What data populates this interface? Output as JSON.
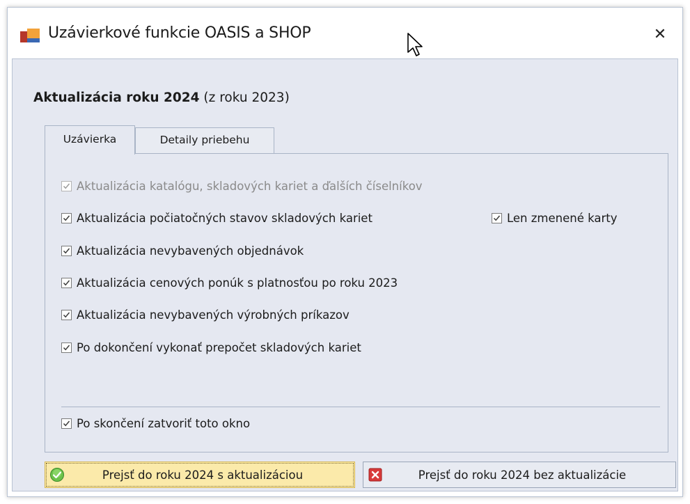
{
  "window": {
    "title": "Uzávierkové funkcie OASIS a SHOP",
    "close_glyph": "✕",
    "logo_icon": "oasis-logo-icon"
  },
  "heading": {
    "bold": "Aktualizácia roku 2024",
    "rest": " (z roku 2023)"
  },
  "tabs": [
    {
      "label": "Uzávierka",
      "active": true
    },
    {
      "label": "Detaily priebehu",
      "active": false
    }
  ],
  "options": [
    {
      "label": "Aktualizácia katalógu, skladových kariet a ďalších číselníkov",
      "checked": true,
      "disabled": true
    },
    {
      "label": "Aktualizácia počiatočných stavov skladových kariet",
      "checked": true,
      "disabled": false
    },
    {
      "label": "Aktualizácia nevybavených objednávok",
      "checked": true,
      "disabled": false
    },
    {
      "label": "Aktualizácia cenových ponúk s platnosťou po roku 2023",
      "checked": true,
      "disabled": false
    },
    {
      "label": "Aktualizácia nevybavených výrobných príkazov",
      "checked": true,
      "disabled": false
    },
    {
      "label": "Po dokončení vykonať prepočet skladových kariet",
      "checked": true,
      "disabled": false
    }
  ],
  "side_option": {
    "label": "Len zmenené karty",
    "checked": true
  },
  "close_option": {
    "label": "Po skončení zatvoriť toto okno",
    "checked": true
  },
  "buttons": {
    "primary": {
      "label": "Prejsť do roku 2024 s aktualizáciou",
      "icon": "green-check-circle-icon"
    },
    "secondary": {
      "label": "Prejsť do roku 2024 bez aktualizácie",
      "icon": "red-x-icon"
    }
  },
  "colors": {
    "panel_bg": "#e5e8f1",
    "primary_button_bg": "#fbeaaa",
    "check_green": "#3aa33a",
    "x_red": "#d83a3a"
  }
}
